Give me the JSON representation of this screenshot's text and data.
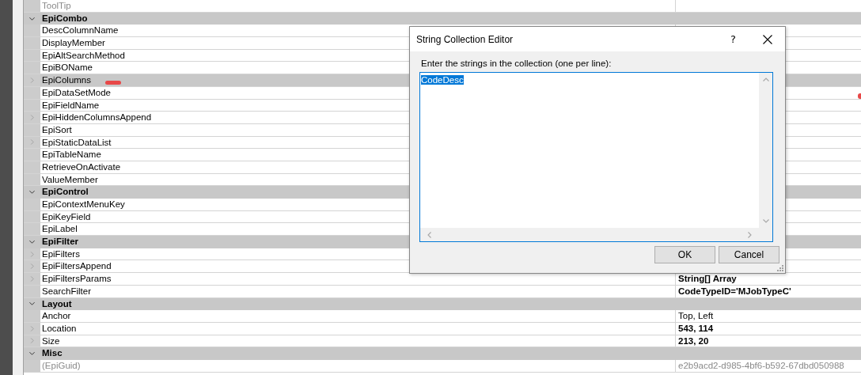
{
  "property_grid": {
    "sections": [
      {
        "properties": [
          {
            "name": "ToolTip",
            "read_only": true,
            "expandable": false,
            "selected": false
          }
        ]
      },
      {
        "name": "EpiCombo",
        "expanded": true,
        "properties": [
          {
            "name": "DescColumnName",
            "read_only": false,
            "expandable": false,
            "selected": false
          },
          {
            "name": "DisplayMember",
            "read_only": false,
            "expandable": false,
            "selected": false
          },
          {
            "name": "EpiAltSearchMethod",
            "read_only": false,
            "expandable": false,
            "selected": false
          },
          {
            "name": "EpiBOName",
            "read_only": false,
            "expandable": false,
            "selected": false
          },
          {
            "name": "EpiColumns",
            "read_only": false,
            "expandable": true,
            "selected": true
          },
          {
            "name": "EpiDataSetMode",
            "read_only": false,
            "expandable": false,
            "selected": false
          },
          {
            "name": "EpiFieldName",
            "read_only": false,
            "expandable": false,
            "selected": false
          },
          {
            "name": "EpiHiddenColumnsAppend",
            "read_only": false,
            "expandable": true,
            "selected": false
          },
          {
            "name": "EpiSort",
            "read_only": false,
            "expandable": false,
            "selected": false
          },
          {
            "name": "EpiStaticDataList",
            "read_only": false,
            "expandable": true,
            "selected": false
          },
          {
            "name": "EpiTableName",
            "read_only": false,
            "expandable": false,
            "selected": false
          },
          {
            "name": "RetrieveOnActivate",
            "read_only": false,
            "expandable": false,
            "selected": false
          },
          {
            "name": "ValueMember",
            "read_only": false,
            "expandable": false,
            "selected": false
          }
        ]
      },
      {
        "name": "EpiControl",
        "expanded": true,
        "properties": [
          {
            "name": "EpiContextMenuKey",
            "read_only": false,
            "expandable": false,
            "selected": false
          },
          {
            "name": "EpiKeyField",
            "read_only": false,
            "expandable": false,
            "selected": false
          },
          {
            "name": "EpiLabel",
            "read_only": false,
            "expandable": false,
            "selected": false
          }
        ]
      },
      {
        "name": "EpiFilter",
        "expanded": true,
        "properties": [
          {
            "name": "EpiFilters",
            "read_only": false,
            "expandable": true,
            "selected": false
          },
          {
            "name": "EpiFiltersAppend",
            "read_only": false,
            "expandable": true,
            "selected": false
          },
          {
            "name": "EpiFiltersParams",
            "read_only": false,
            "expandable": true,
            "selected": false,
            "value": "String[] Array",
            "modified": true
          },
          {
            "name": "SearchFilter",
            "read_only": false,
            "expandable": false,
            "selected": false,
            "value": "CodeTypeID='MJobTypeC'",
            "modified": true
          }
        ]
      },
      {
        "name": "Layout",
        "expanded": true,
        "properties": [
          {
            "name": "Anchor",
            "read_only": false,
            "expandable": false,
            "selected": false,
            "value": "Top, Left",
            "modified": false
          },
          {
            "name": "Location",
            "read_only": false,
            "expandable": true,
            "selected": false,
            "value": "543, 114",
            "modified": true
          },
          {
            "name": "Size",
            "read_only": false,
            "expandable": true,
            "selected": false,
            "value": "213, 20",
            "modified": true
          }
        ]
      },
      {
        "name": "Misc",
        "expanded": true,
        "properties": [
          {
            "name": "(EpiGuid)",
            "read_only": true,
            "expandable": false,
            "selected": false,
            "value": "e2b9acd2-d985-4bf6-b592-67dbd050988",
            "modified": false
          }
        ]
      }
    ]
  },
  "dialog": {
    "title": "String Collection Editor",
    "help_button": "?",
    "prompt": "Enter the strings in the collection (one per line):",
    "lines": [
      "CodeDesc"
    ],
    "text_selected": true,
    "buttons": [
      {
        "label": "OK"
      },
      {
        "label": "Cancel"
      }
    ]
  }
}
